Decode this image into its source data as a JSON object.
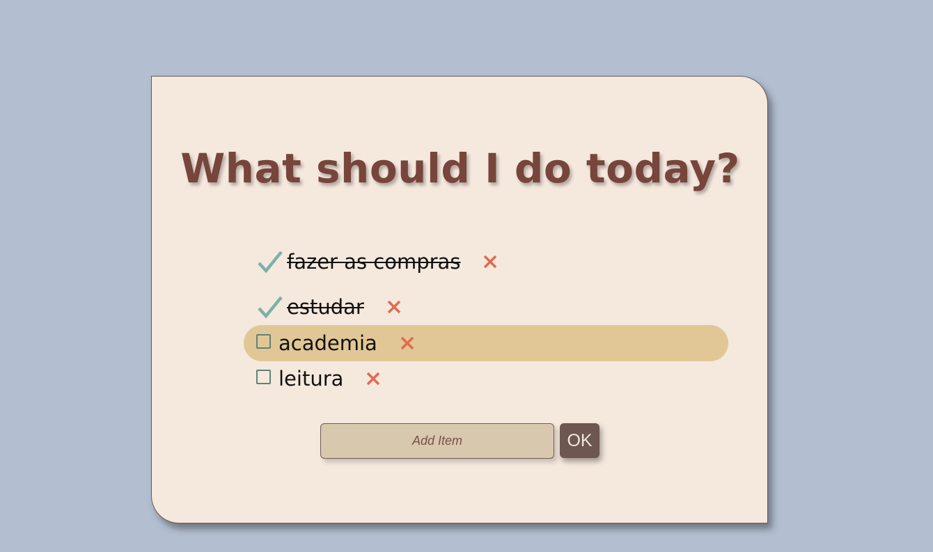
{
  "title": "What should I do today?",
  "items": [
    {
      "label": "fazer as compras",
      "done": true
    },
    {
      "label": "estudar",
      "done": true
    },
    {
      "label": "academia",
      "done": false,
      "highlighted": true
    },
    {
      "label": "leitura",
      "done": false
    }
  ],
  "add_form": {
    "placeholder": "Add Item",
    "value": "",
    "ok_label": "OK"
  },
  "colors": {
    "background": "#b3bfd1",
    "card": "#f5e8dd",
    "title": "#77453b",
    "check": "#7cb1a8",
    "checkbox_border": "#5e8279",
    "delete": "#e2694f",
    "highlight": "#e1c795",
    "input": "#d8c8ae",
    "ok_button": "#6e5651"
  },
  "icons": {
    "done_marker": "check-icon",
    "todo_marker": "empty-checkbox",
    "remove": "close-icon"
  }
}
